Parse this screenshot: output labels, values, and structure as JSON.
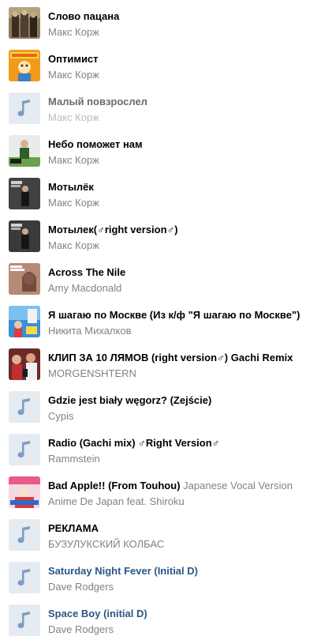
{
  "colors": {
    "title": "#000000",
    "title_unavailable": "#6b6b6b",
    "title_link": "#2a5885",
    "artist": "#828282",
    "artist_unavailable": "#b8bcc0",
    "placeholder_bg": "#e5ebf1",
    "note_icon": "#7a9cc6"
  },
  "tracks": [
    {
      "title": "Слово пацана",
      "artist": "Макс Корж",
      "cover": "album-cover"
    },
    {
      "title": "Оптимист",
      "artist": "Макс Корж",
      "cover": "album-cover"
    },
    {
      "title": "Малый повзрослел",
      "artist": "Макс Корж",
      "cover": "music-note-icon"
    },
    {
      "title": "Небо поможет нам",
      "artist": "Макс Корж",
      "cover": "album-cover"
    },
    {
      "title": "Мотылёк",
      "artist": "Макс Корж",
      "cover": "album-cover"
    },
    {
      "title": "Мотылек(♂right version♂)",
      "artist": "Макс Корж",
      "cover": "album-cover"
    },
    {
      "title": "Across The Nile",
      "artist": "Amy Macdonald",
      "cover": "album-cover"
    },
    {
      "title": "Я шагаю по Москве (Из к/ф \"Я шагаю по Москве\")",
      "artist": "Никита Михалков",
      "cover": "album-cover"
    },
    {
      "title": "КЛИП ЗА 10 ЛЯМОВ (right version♂) Gachi Remix",
      "artist": "MORGENSHTERN",
      "cover": "album-cover"
    },
    {
      "title": "Gdzie jest biały węgorz? (Zejście)",
      "artist": "Cypis",
      "cover": "music-note-icon"
    },
    {
      "title": "Radio (Gachi mix) ♂Right Version♂",
      "artist": "Rammstein",
      "cover": "music-note-icon"
    },
    {
      "title": "Bad Apple!! (From Touhou)",
      "subtitle": "Japanese Vocal Version",
      "artist": "Anime De Japan feat. Shiroku",
      "cover": "album-cover"
    },
    {
      "title": "РЕКЛАМА",
      "artist": "БУЗУЛУКСКИЙ КОЛБАС",
      "cover": "music-note-icon"
    },
    {
      "title": "Saturday Night Fever (Initial D)",
      "artist": "Dave Rodgers",
      "cover": "music-note-icon"
    },
    {
      "title": "Space Boy (initial D)",
      "artist": "Dave Rodgers",
      "cover": "music-note-icon"
    }
  ]
}
